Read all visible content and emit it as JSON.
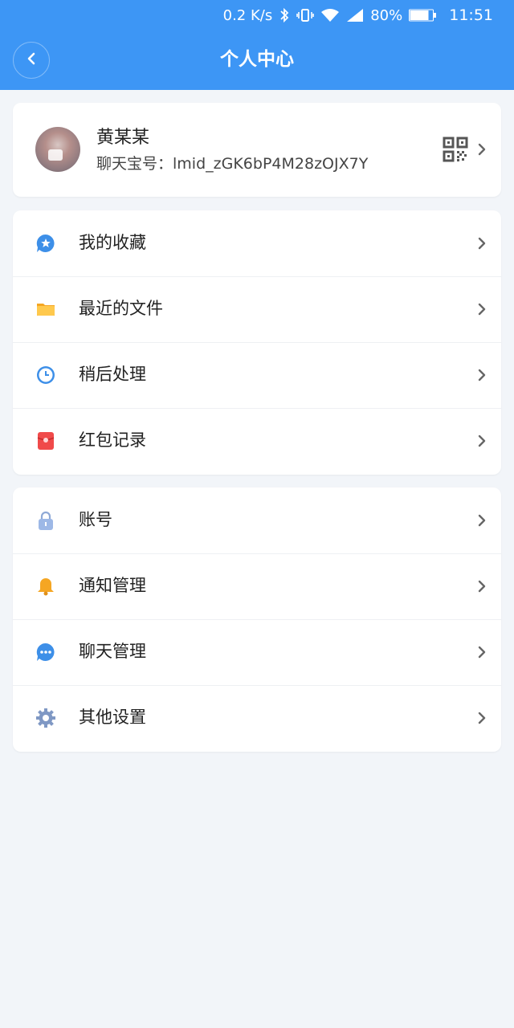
{
  "status_bar": {
    "net_speed": "0.2 K/s",
    "battery": "80%",
    "time": "11:51"
  },
  "header": {
    "title": "个人中心"
  },
  "profile": {
    "name": "黄某某",
    "id_label": "聊天宝号：",
    "id_value": "lmid_zGK6bP4M28zOJX7Y"
  },
  "menu_group_1": [
    {
      "label": "我的收藏",
      "icon": "star-bubble-icon"
    },
    {
      "label": "最近的文件",
      "icon": "folder-icon"
    },
    {
      "label": "稍后处理",
      "icon": "clock-icon"
    },
    {
      "label": "红包记录",
      "icon": "red-envelope-icon"
    }
  ],
  "menu_group_2": [
    {
      "label": "账号",
      "icon": "lock-icon"
    },
    {
      "label": "通知管理",
      "icon": "bell-icon"
    },
    {
      "label": "聊天管理",
      "icon": "chat-bubble-icon"
    },
    {
      "label": "其他设置",
      "icon": "gear-icon"
    }
  ],
  "colors": {
    "header": "#3d96f5",
    "background": "#f2f5f9",
    "icon_blue": "#3d8fe8",
    "icon_orange": "#f5a623",
    "icon_red": "#f04a4a"
  }
}
